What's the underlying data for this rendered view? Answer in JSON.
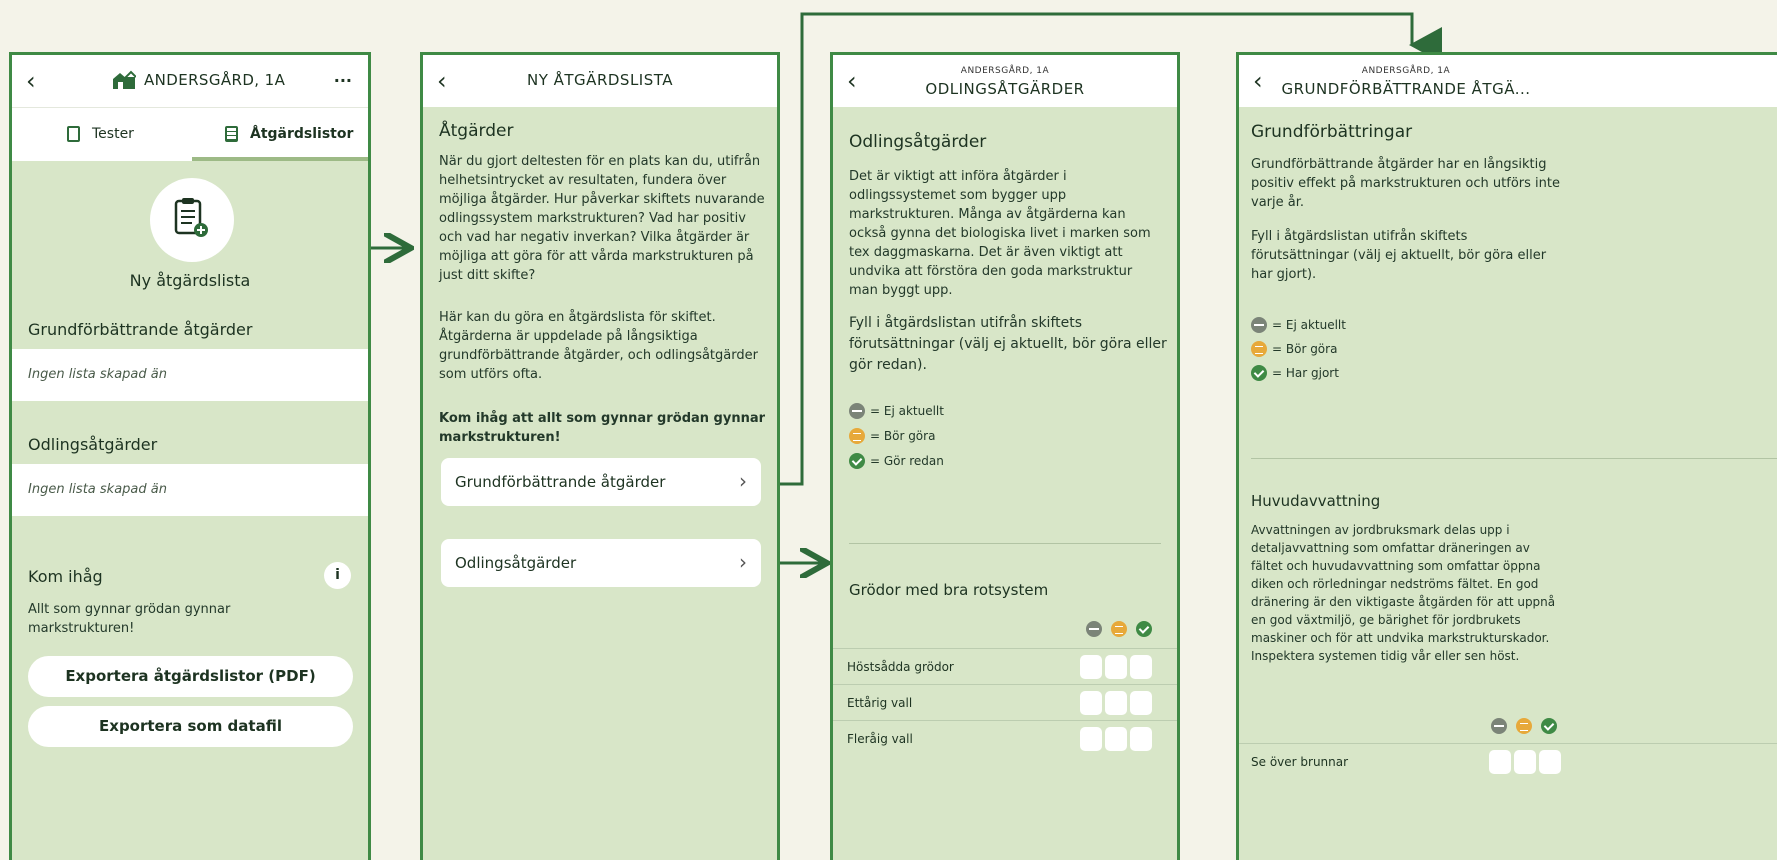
{
  "colors": {
    "accent": "#3f8a45",
    "panel_bg": "#d8e6c8",
    "page_bg": "#f4f3e9",
    "orange": "#e7a93a",
    "grey": "#7b8478"
  },
  "screen1": {
    "title": "ANDERSGÅRD, 1A",
    "more": "···",
    "tabs": {
      "tester": "Tester",
      "atgardslistor": "Åtgärdslistor"
    },
    "new_list_label": "Ny åtgärdslista",
    "section1_title": "Grundförbättrande åtgärder",
    "section1_empty": "Ingen lista skapad än",
    "section2_title": "Odlingsåtgärder",
    "section2_empty": "Ingen lista skapad än",
    "remember_title": "Kom ihåg",
    "info": "i",
    "remember_text1": "Allt som gynnar grödan gynnar",
    "remember_text2": "markstrukturen!",
    "export_pdf": "Exportera åtgärdslistor (PDF)",
    "export_data": "Exportera som datafil"
  },
  "screen2": {
    "title": "NY ÅTGÄRDSLISTA",
    "heading": "Åtgärder",
    "para1": [
      "När du gjort deltesten för en plats kan du, utifrån",
      "helhetsintrycket av resultaten, fundera över",
      "möjliga åtgärder. Hur påverkar skiftets nuvarande",
      "odlingssystem markstrukturen? Vad har positiv",
      "och vad har negativ inverkan? Vilka åtgärder är",
      "möjliga att göra för att vårda markstrukturen på",
      "just ditt skifte?"
    ],
    "para2": [
      "Här kan du göra en åtgärdslista för skiftet.",
      "Åtgärderna är uppdelade på långsiktiga",
      "grundförbättrande åtgärder, och odlingsåtgärder",
      "som utförs ofta."
    ],
    "bold1": "Kom ihåg att allt som gynnar grödan gynnar",
    "bold2": "markstrukturen!",
    "btn1": "Grundförbättrande åtgärder",
    "btn2": "Odlingsåtgärder",
    "chev": "›"
  },
  "screen3": {
    "subtitle": "ANDERSGÅRD, 1A",
    "title": "ODLINGSÅTGÄRDER",
    "heading": "Odlingsåtgärder",
    "para1": [
      "Det är viktigt att införa åtgärder i",
      "odlingssystemet som bygger upp",
      "markstrukturen. Många av åtgärderna kan",
      "också gynna det biologiska livet i marken som",
      "tex daggmaskarna. Det är även viktigt att",
      "undvika att förstöra den goda markstruktur",
      "man byggt upp."
    ],
    "para2": [
      "Fyll i åtgärdslistan utifrån skiftets",
      "förutsättningar (välj ej aktuellt, bör göra eller",
      "gör redan)."
    ],
    "legend": [
      "= Ej aktuellt",
      "= Bör göra",
      "= Gör redan"
    ],
    "table_title": "Grödor med bra rotsystem",
    "rows": [
      "Höstsådda grödor",
      "Ettårig vall",
      "Fleråig vall"
    ]
  },
  "screen4": {
    "subtitle": "ANDERSGÅRD, 1A",
    "title": "GRUNDFÖRBÄTTRANDE ÅTGÄ...",
    "heading": "Grundförbättringar",
    "para1": [
      "Grundförbättrande åtgärder har en långsiktig",
      "positiv effekt på markstrukturen och utförs inte",
      "varje år."
    ],
    "para2": [
      "Fyll i åtgärdslistan utifrån skiftets",
      "förutsättningar (välj ej aktuellt, bör göra eller",
      "har gjort)."
    ],
    "legend": [
      "= Ej aktuellt",
      "= Bör göra",
      "= Har gjort"
    ],
    "section_title": "Huvudavvattning",
    "para3": [
      "Avvattningen av jordbruksmark delas upp i",
      "detaljavvattning som omfattar dräneringen av",
      "fältet och huvudavvattning som omfattar öppna",
      "diken och rörledningar nedströms fältet. En god",
      "dränering är den viktigaste åtgärden för att uppnå",
      "en god växtmiljö, ge bärighet för jordbrukets",
      "maskiner och för att undvika markstrukturskador.",
      "Inspektera systemen tidig vår eller sen höst."
    ],
    "rows": [
      "Se över brunnar"
    ]
  }
}
